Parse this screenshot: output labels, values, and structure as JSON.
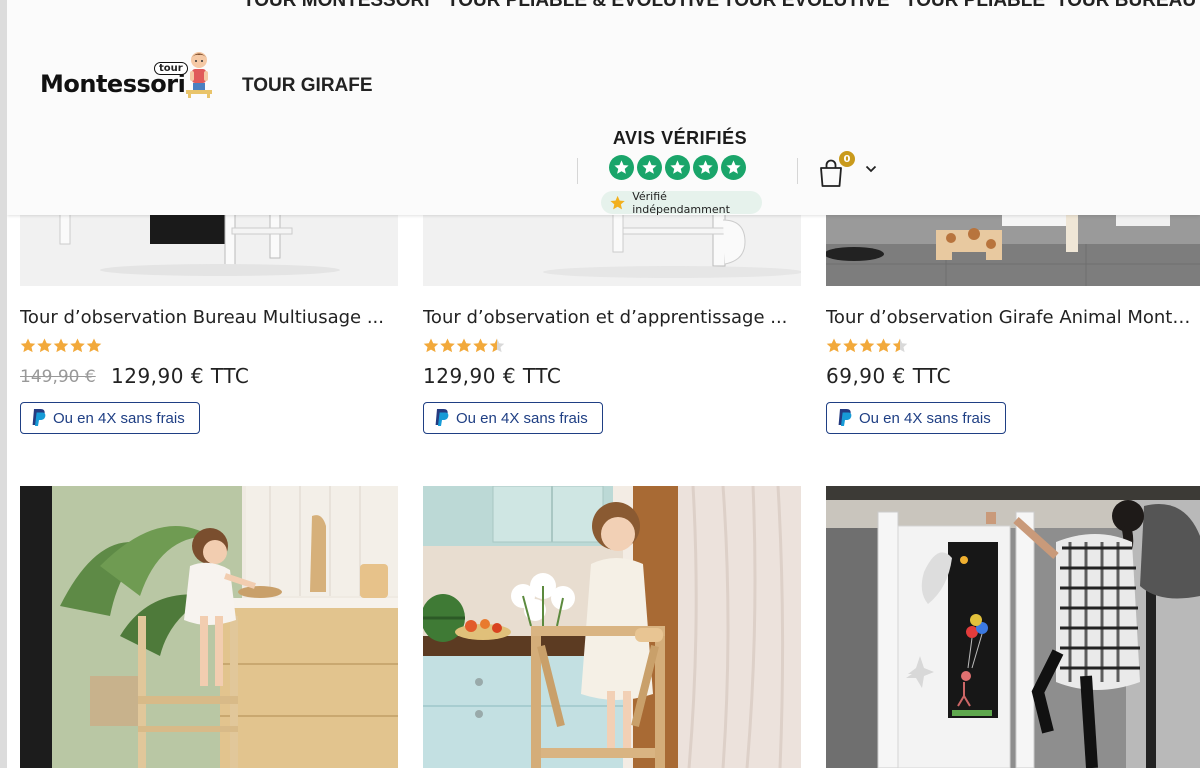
{
  "header": {
    "top_nav": [
      "TOUR MONTESSORI",
      "TOUR PLIABLE & ÉVOLUTIVE",
      "TOUR ÉVOLUTIVE",
      "TOUR PLIABLE",
      "TOUR BUREAU"
    ],
    "logo_text": "Montessori",
    "logo_tag": "tour",
    "nav_second": "TOUR GIRAFE",
    "avis": {
      "title": "AVIS VÉRIFIÉS",
      "badge": "Vérifié indépendamment",
      "stars": 5
    },
    "cart_count": "0"
  },
  "products": [
    {
      "title": "Tour d’observation Bureau Multiusage ...",
      "rating": 5,
      "old_price": "149,90 €",
      "price": "129,90 € TTC",
      "pay": "Ou en 4X sans frais"
    },
    {
      "title": "Tour d’observation et d’apprentissage ...",
      "rating": 4.5,
      "old_price": "",
      "price": "129,90 € TTC",
      "pay": "Ou en 4X sans frais"
    },
    {
      "title": "Tour d’observation Girafe Animal Monte...",
      "rating": 4.5,
      "old_price": "",
      "price": "69,90 € TTC",
      "pay": "Ou en 4X sans frais"
    }
  ],
  "colors": {
    "star": "#f2a93b",
    "paypal": "#1f3f84",
    "avis_green": "#1aa56a",
    "cart_badge": "#c99a1c"
  }
}
